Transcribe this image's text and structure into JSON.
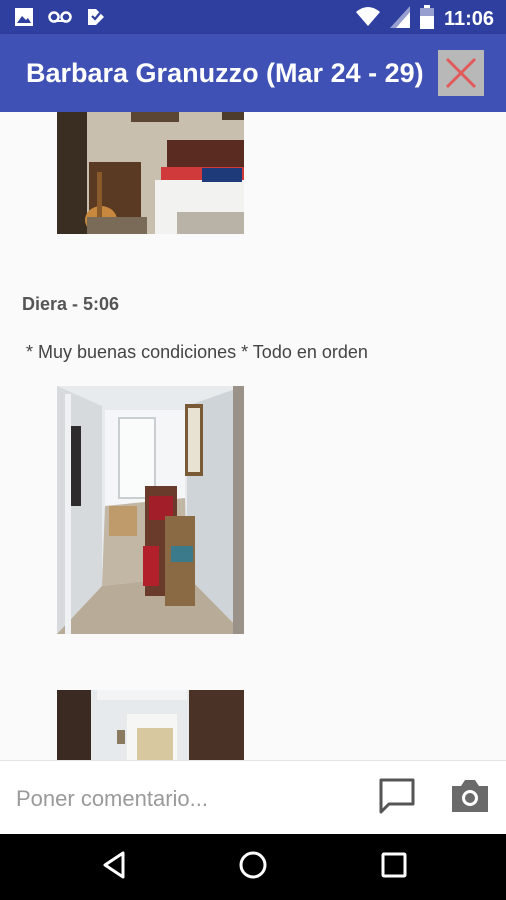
{
  "status_bar": {
    "time": "11:06",
    "icons": [
      "image-icon",
      "voicemail-icon",
      "notification-icon",
      "wifi-icon",
      "signal-icon",
      "battery-icon"
    ]
  },
  "app_bar": {
    "title": "Barbara Granuzzo (Mar 24 - 29)",
    "close_icon": "close-icon",
    "accent": "#3f51b5",
    "status_color": "#2f3fa0"
  },
  "entries": [
    {
      "title": "Diera - 5:06",
      "text": "* Muy buenas condiciones * Todo en orden"
    }
  ],
  "comment_bar": {
    "placeholder": "Poner comentario...",
    "comment_icon": "comment-icon",
    "camera_icon": "camera-icon"
  },
  "nav_bar": {
    "icons": [
      "back-icon",
      "home-icon",
      "recents-icon"
    ]
  }
}
